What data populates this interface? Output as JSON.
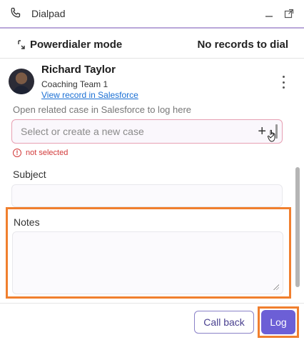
{
  "window": {
    "title": "Dialpad",
    "icons": [
      "phone-icon",
      "minimize-icon",
      "popout-icon"
    ]
  },
  "mode_bar": {
    "mode_label": "Powerdialer mode",
    "status": "No records to dial",
    "icon": "powerdialer-icon"
  },
  "contact": {
    "name": "Richard Taylor",
    "team": "Coaching Team 1",
    "link": "View record in Salesforce",
    "menu_icon": "more-vertical-icon"
  },
  "case": {
    "label": "Open related case in Salesforce to log here",
    "placeholder": "Select or create a new case",
    "add_glyph": "+",
    "error_glyph": "!",
    "error": "not selected"
  },
  "subject": {
    "label": "Subject",
    "value": ""
  },
  "notes": {
    "label": "Notes",
    "value": ""
  },
  "footer": {
    "callback_label": "Call back",
    "log_label": "Log"
  },
  "colors": {
    "accent": "#6c5fd6",
    "highlight": "#f07f2e",
    "error": "#d23a3a",
    "link": "#1a6fd4"
  }
}
